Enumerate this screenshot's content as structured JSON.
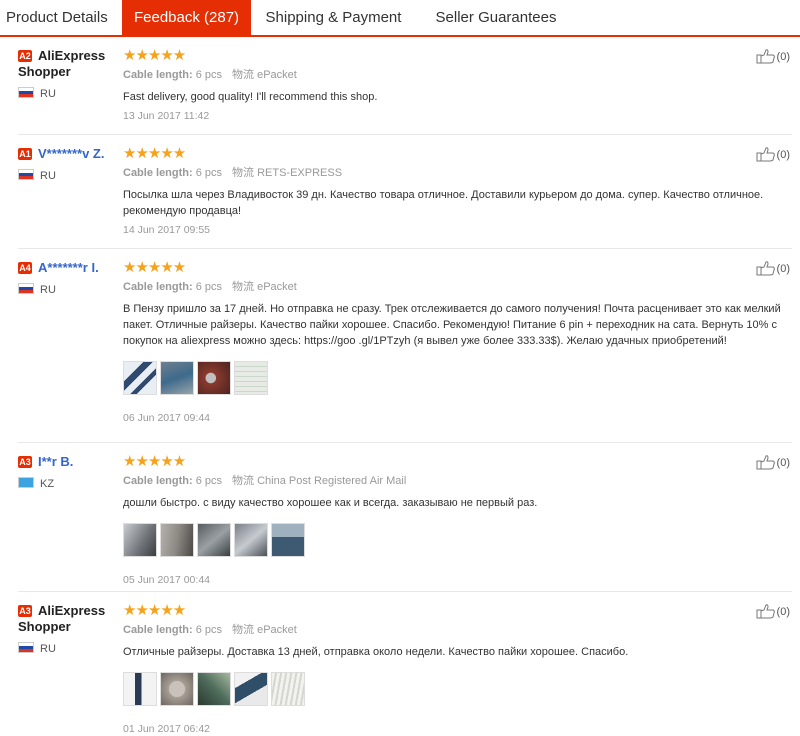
{
  "tabs": [
    {
      "label": "Product Details",
      "active": false
    },
    {
      "label": "Feedback (287)",
      "active": true
    },
    {
      "label": "Shipping & Payment",
      "active": false
    },
    {
      "label": "Seller Guarantees",
      "active": false
    }
  ],
  "colors": {
    "accent": "#e62e04",
    "star": "#f7a21b",
    "link": "#3366cc"
  },
  "reviews": [
    {
      "level": "A2",
      "name_line1": "AliExpress",
      "name_line2": "Shopper",
      "name_is_link": false,
      "country": "RU",
      "stars": "★★★★★",
      "rating": 5,
      "attr_label": "Cable length:",
      "attr_value": "6 pcs",
      "ship_label": "物流",
      "ship_value": "ePacket",
      "text": "Fast delivery, good quality! I'll recommend this shop.",
      "photos": [],
      "date": "13 Jun 2017 11:42",
      "helpful_count": "(0)",
      "thumbs_icon": "thumbs-up-icon"
    },
    {
      "level": "A1",
      "name_line1": "V*******v Z.",
      "name_line2": "",
      "name_is_link": true,
      "country": "RU",
      "stars": "★★★★★",
      "rating": 5,
      "attr_label": "Cable length:",
      "attr_value": "6 pcs",
      "ship_label": "物流",
      "ship_value": "RETS-EXPRESS",
      "text": "Посылка шла через Владивосток 39 дн. Качество товара отличное. Доставили курьером до дома. супер. Качество отличное. рекомендую продавца!",
      "photos": [],
      "date": "14 Jun 2017 09:55",
      "helpful_count": "(0)",
      "thumbs_icon": "thumbs-up-icon"
    },
    {
      "level": "A4",
      "name_line1": "A*******r I.",
      "name_line2": "",
      "name_is_link": true,
      "country": "RU",
      "stars": "★★★★★",
      "rating": 5,
      "attr_label": "Cable length:",
      "attr_value": "6 pcs",
      "ship_label": "物流",
      "ship_value": "ePacket",
      "text": "В Пензу пришло за 17 дней. Но отправка не сразу. Трек отслеживается до самого получения! Почта расценивает это как мелкий пакет. Отличные райзеры. Качество пайки хорошее. Спасибо. Рекомендую! Питание 6 pin + переходник на сата. Вернуть 10% с покупок на aliexpress можно здесь: https://goo .gl/1PTzyh (я вывел уже более 333.33$). Желаю удачных приобретений!",
      "photos": [
        "#2f4a6e",
        "#6f7f8e",
        "#8a3a2e",
        "#e8eae6"
      ],
      "date": "06 Jun 2017 09:44",
      "helpful_count": "(0)",
      "thumbs_icon": "thumbs-up-icon"
    },
    {
      "level": "A3",
      "name_line1": "I**r B.",
      "name_line2": "",
      "name_is_link": true,
      "country": "KZ",
      "stars": "★★★★★",
      "rating": 5,
      "attr_label": "Cable length:",
      "attr_value": "6 pcs",
      "ship_label": "物流",
      "ship_value": "China Post Registered Air Mail",
      "text": "дошли быстро. с виду качество хорошее как и всегда. заказываю не первый раз.",
      "photos": [
        "#6e7277",
        "#8d8a86",
        "#585c5e",
        "#7a8088",
        "#3e5a72"
      ],
      "date": "05 Jun 2017 00:44",
      "helpful_count": "(0)",
      "thumbs_icon": "thumbs-up-icon"
    },
    {
      "level": "A3",
      "name_line1": "AliExpress",
      "name_line2": "Shopper",
      "name_is_link": false,
      "country": "RU",
      "stars": "★★★★★",
      "rating": 5,
      "attr_label": "Cable length:",
      "attr_value": "6 pcs",
      "ship_label": "物流",
      "ship_value": "ePacket",
      "text": "Отличные райзеры. Доставка 13 дней, отправка около недели. Качество пайки хорошее. Спасибо.",
      "photos": [
        "#2a3a55",
        "#a8a096",
        "#4c6a5a",
        "#2f4e68",
        "#d6d6d0"
      ],
      "date": "01 Jun 2017 06:42",
      "helpful_count": "(0)",
      "thumbs_icon": "thumbs-up-icon"
    }
  ]
}
